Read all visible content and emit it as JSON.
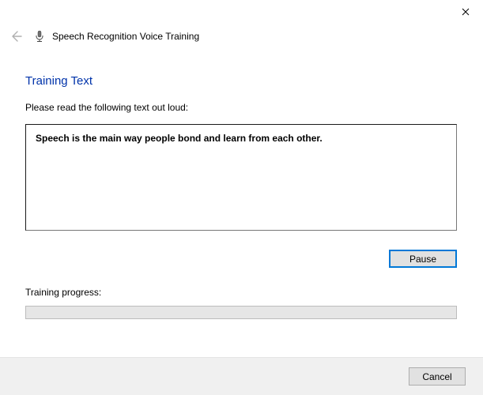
{
  "header": {
    "title": "Speech Recognition Voice Training"
  },
  "main": {
    "heading": "Training Text",
    "instruction": "Please read the following text out loud:",
    "speech_text": "Speech is the main way people bond and learn from each other.",
    "pause_label": "Pause",
    "progress_label": "Training progress:"
  },
  "footer": {
    "cancel_label": "Cancel"
  }
}
